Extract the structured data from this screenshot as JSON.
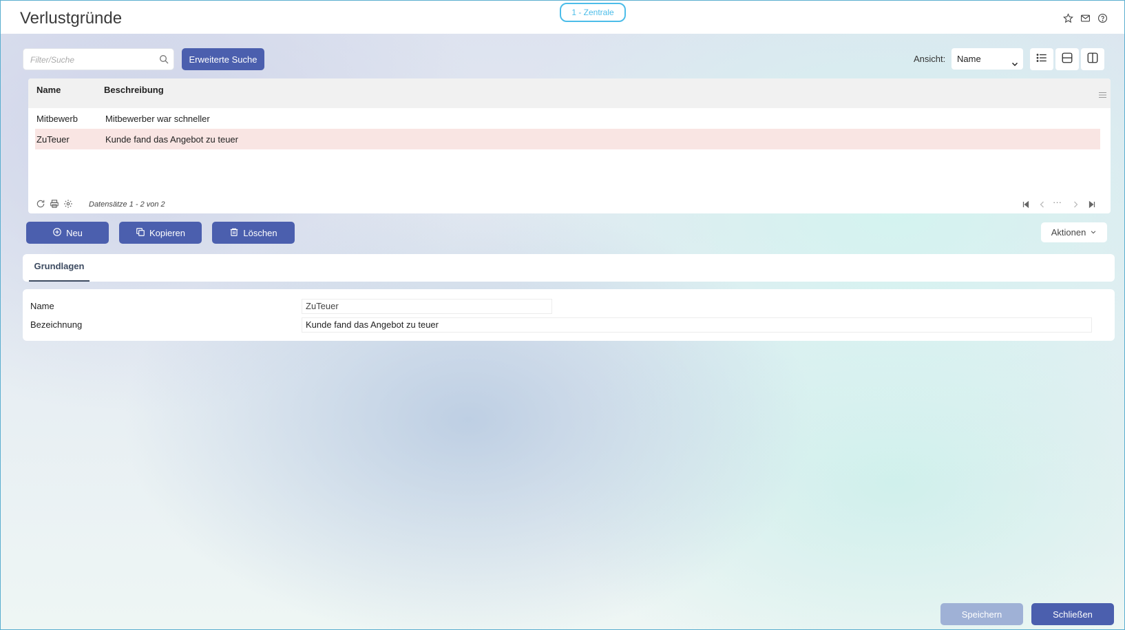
{
  "header": {
    "title": "Verlustgründe",
    "mandant": "1 - Zentrale",
    "icons": [
      "star-icon",
      "mail-icon",
      "help-icon"
    ]
  },
  "toolbar": {
    "search_placeholder": "Filter/Suche",
    "search_value": "",
    "advanced_search_label": "Erweiterte Suche",
    "view_label": "Ansicht:",
    "view_value": "Name",
    "view_buttons": [
      "list-view-icon",
      "split-horizontal-icon",
      "split-vertical-icon"
    ]
  },
  "grid": {
    "columns": [
      "Name",
      "Beschreibung"
    ],
    "rows": [
      {
        "name": "Mitbewerb",
        "description": "Mitbewerber war schneller",
        "selected": false
      },
      {
        "name": "ZuTeuer",
        "description": "Kunde fand das Angebot zu teuer",
        "selected": true
      }
    ],
    "record_info": "Datensätze 1 - 2 von 2",
    "pager_ellipsis": "···"
  },
  "actions": {
    "new_label": "Neu",
    "copy_label": "Kopieren",
    "delete_label": "Löschen",
    "more_label": "Aktionen"
  },
  "tabs": [
    {
      "label": "Grundlagen",
      "active": true
    }
  ],
  "form": {
    "name_label": "Name",
    "name_value": "ZuTeuer",
    "description_label": "Bezeichnung",
    "description_value": "Kunde fand das Angebot zu teuer"
  },
  "footer": {
    "save_label": "Speichern",
    "close_label": "Schließen"
  },
  "colors": {
    "primary": "#4b5fae",
    "primary_disabled": "#9fb1d6",
    "selected_row": "#f9e5e3",
    "mandant_accent": "#4cbde9"
  }
}
